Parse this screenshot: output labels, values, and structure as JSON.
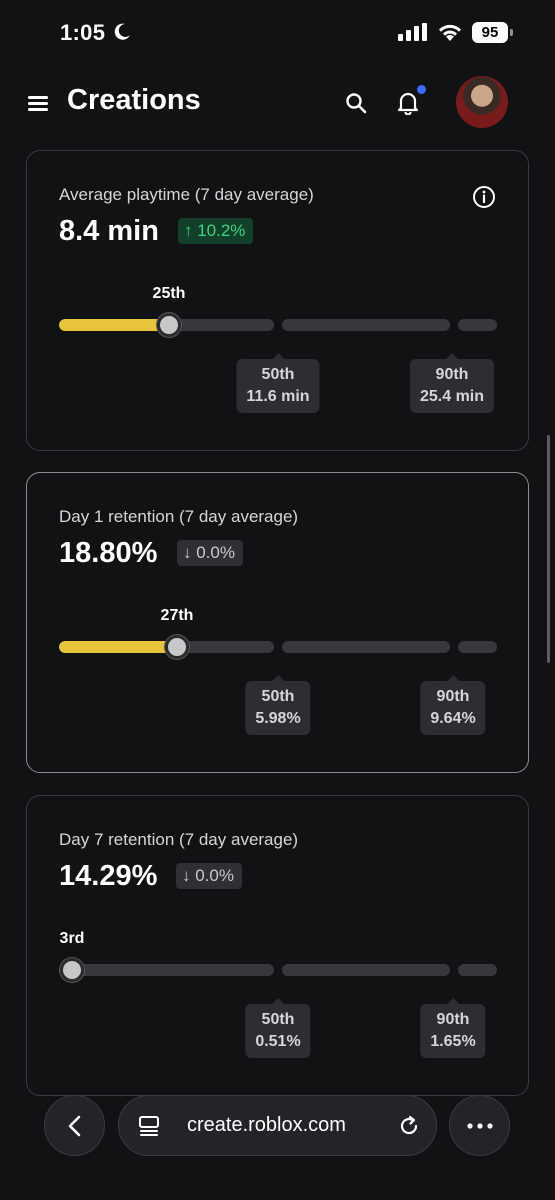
{
  "status_bar": {
    "time": "1:05",
    "battery": "95"
  },
  "header": {
    "title": "Creations"
  },
  "metrics": [
    {
      "title": "Average playtime (7 day average)",
      "value": "8.4 min",
      "delta": "↑ 10.2%",
      "delta_direction": "up",
      "rank": "25th",
      "rank_fraction": 0.25,
      "markers": [
        {
          "percentile": "50th",
          "value": "11.6 min"
        },
        {
          "percentile": "90th",
          "value": "25.4 min"
        }
      ]
    },
    {
      "title": "Day 1 retention (7 day average)",
      "value": "18.80%",
      "delta": "↓ 0.0%",
      "delta_direction": "flat",
      "rank": "27th",
      "rank_fraction": 0.27,
      "markers": [
        {
          "percentile": "50th",
          "value": "5.98%"
        },
        {
          "percentile": "90th",
          "value": "9.64%"
        }
      ]
    },
    {
      "title": "Day 7 retention (7 day average)",
      "value": "14.29%",
      "delta": "↓ 0.0%",
      "delta_direction": "flat",
      "rank": "3rd",
      "rank_fraction": 0.03,
      "markers": [
        {
          "percentile": "50th",
          "value": "0.51%"
        },
        {
          "percentile": "90th",
          "value": "1.65%"
        }
      ]
    }
  ],
  "browser": {
    "url": "create.roblox.com"
  },
  "colors": {
    "accent": "#e8c43a",
    "up": "#3ed47f",
    "background": "#111214"
  },
  "icons": [
    "moon-icon",
    "signal-icon",
    "wifi-icon",
    "menu-icon",
    "search-icon",
    "bell-icon",
    "info-icon",
    "back-icon",
    "tabs-icon",
    "reload-icon",
    "more-icon"
  ]
}
